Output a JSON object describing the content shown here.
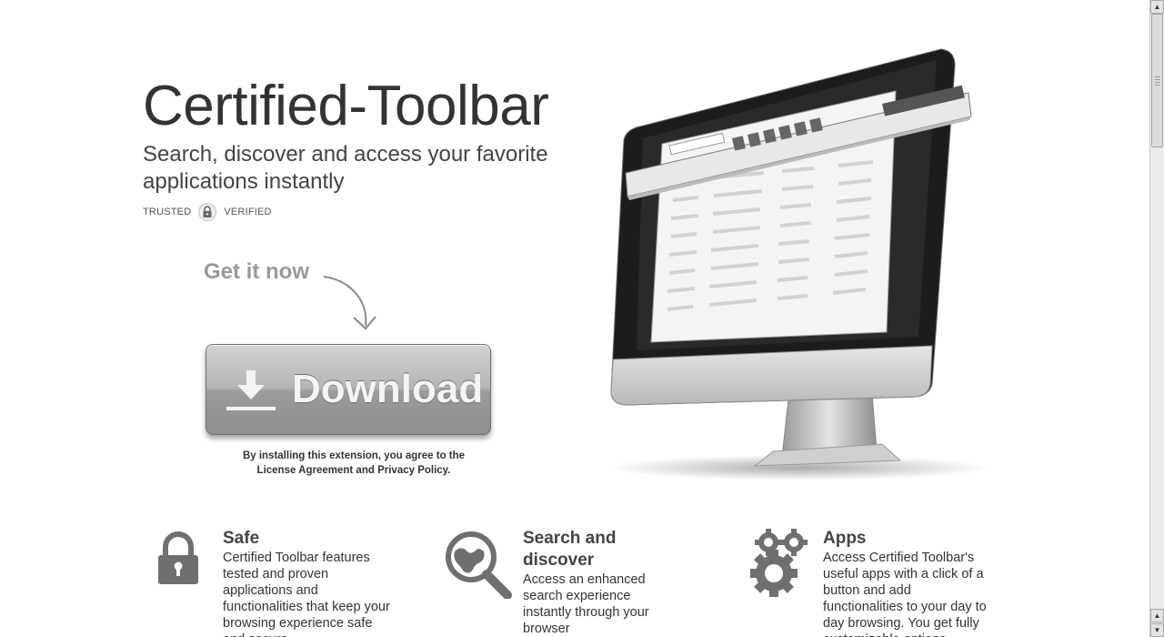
{
  "hero": {
    "title": "Certified-Toolbar",
    "subtitle": "Search, discover and access your favorite applications instantly",
    "trusted": "TRUSTED",
    "verified": "VERIFIED",
    "get_it_now": "Get it now",
    "download_label": "Download",
    "legal_prefix": "By installing this extension, you agree to the",
    "license_link": "License Agreement",
    "legal_and": "and",
    "privacy_link": "Privacy Policy",
    "legal_suffix": "."
  },
  "features": [
    {
      "title": "Safe",
      "text": "Certified Toolbar features tested and proven applications and functionalities that keep your browsing experience safe and secure."
    },
    {
      "title": "Search and discover",
      "text": "Access an enhanced search experience instantly through your browser"
    },
    {
      "title": "Apps",
      "text": "Access Certified Toolbar's useful apps with a click of a button and add functionalities to your day to day browsing. You get fully customizable options."
    }
  ],
  "icons": [
    "lock-icon",
    "download-arrow-icon",
    "curved-arrow-icon",
    "padlock-icon",
    "globe-magnifier-icon",
    "gears-icon"
  ],
  "colors": {
    "button_top": "#d2d2d2",
    "button_bottom": "#8d8d8d",
    "text": "#333333",
    "muted": "#9a9a9a"
  }
}
